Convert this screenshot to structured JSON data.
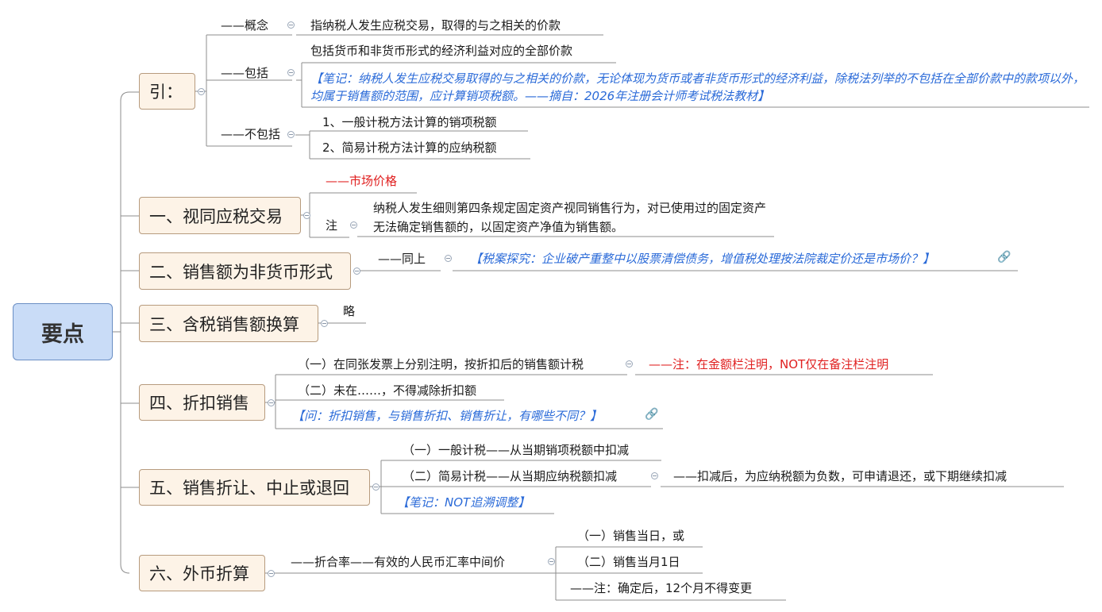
{
  "root": "要点",
  "branches": {
    "intro": {
      "label": "引：",
      "concept": {
        "label": "——概念",
        "text": "指纳税人发生应税交易，取得的与之相关的价款"
      },
      "include": {
        "label": "——包括",
        "text": "包括货币和非货币形式的经济利益对应的全部价款",
        "note": "【笔记：纳税人发生应税交易取得的与之相关的价款，无论体现为货币或者非货币形式的经济利益，除税法列举的不包括在全部价款中的款项以外，均属于销售额的范围，应计算销项税额。——摘自：2026年注册会计师考试税法教材】"
      },
      "exclude": {
        "label": "——不包括",
        "items": [
          "1、一般计税方法计算的销项税额",
          "2、简易计税方法计算的应纳税额"
        ]
      }
    },
    "b1": {
      "label": "一、视同应税交易",
      "market": "——市场价格",
      "note_label": "注",
      "note_text": "纳税人发生细则第四条规定固定资产视同销售行为，对已使用过的固定资产无法确定销售额的，以固定资产净值为销售额。"
    },
    "b2": {
      "label": "二、销售额为非货币形式",
      "same": "——同上",
      "case": "【税案探究：企业破产重整中以股票清偿债务，增值税处理按法院裁定价还是市场价？】"
    },
    "b3": {
      "label": "三、含税销售额换算",
      "text": "略"
    },
    "b4": {
      "label": "四、折扣销售",
      "item1": "（一）在同张发票上分别注明，按折扣后的销售额计税",
      "item1_note": "——注：在金额栏注明，NOT仅在备注栏注明",
      "item2": "（二）未在……，不得减除折扣额",
      "question": "【问：折扣销售，与销售折扣、销售折让，有哪些不同？】"
    },
    "b5": {
      "label": "五、销售折让、中止或退回",
      "item1": "（一）一般计税——从当期销项税额中扣减",
      "item2": "（二）简易计税——从当期应纳税额扣减",
      "item2_note": "——扣减后，为应纳税额为负数，可申请退还，或下期继续扣减",
      "note": "【笔记：NOT追溯调整】"
    },
    "b6": {
      "label": "六、外币折算",
      "rate": "——折合率——有效的人民币汇率中间价",
      "items": [
        "（一）销售当日，或",
        "（二）销售当月1日",
        "——注：确定后，12个月不得变更"
      ]
    }
  },
  "icons": {
    "collapse": "collapse-icon",
    "link": "link-icon"
  },
  "colors": {
    "root_fill": "#c9dcf7",
    "topic_fill": "#fdf3e7",
    "red": "#e02020",
    "blue": "#2a6ad8",
    "line": "#8c8c8c"
  }
}
